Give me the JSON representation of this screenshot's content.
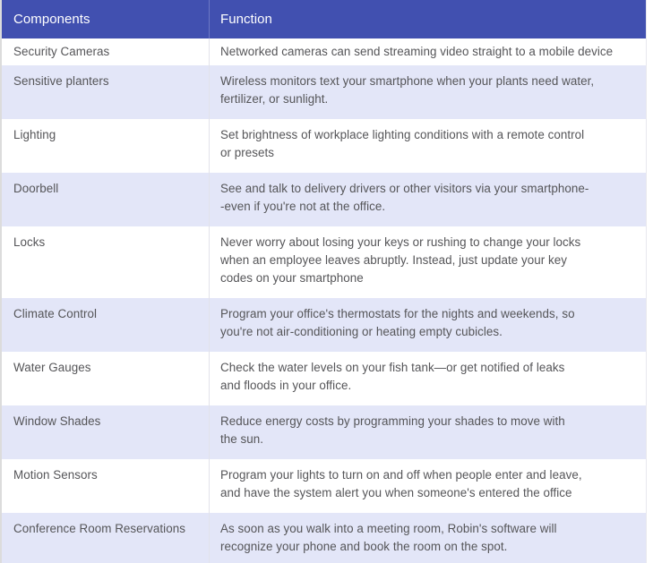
{
  "table": {
    "colors": {
      "header_bg": "#4150b0",
      "header_text": "#ffffff",
      "row_alt_bg": "#e3e6f8",
      "row_bg": "#ffffff",
      "text": "#555558"
    },
    "headers": [
      "Components",
      "Function"
    ],
    "rows": [
      {
        "component": "Security Cameras",
        "function_lines": [
          "Networked cameras can send streaming video straight to a mobile device"
        ]
      },
      {
        "component": "Sensitive planters",
        "function_lines": [
          "Wireless monitors text your smartphone when your plants need water,",
          "fertilizer, or sunlight."
        ]
      },
      {
        "component": "Lighting",
        "function_lines": [
          "Set brightness of workplace lighting conditions with a remote control",
          "or presets"
        ]
      },
      {
        "component": "Doorbell",
        "function_lines": [
          "See and talk to delivery drivers or other visitors via your smartphone-",
          "-even if you're not at the office."
        ]
      },
      {
        "component": "Locks",
        "function_lines": [
          "Never worry about losing your keys or rushing to change your locks",
          "when an employee leaves abruptly. Instead, just update your key",
          "codes on your smartphone"
        ]
      },
      {
        "component": "Climate Control",
        "function_lines": [
          "Program your office's thermostats for the nights and weekends, so",
          "you're not air-conditioning or heating empty cubicles."
        ]
      },
      {
        "component": "Water Gauges",
        "function_lines": [
          "Check the water levels on your fish tank—or get notified of leaks",
          "and floods in your office."
        ]
      },
      {
        "component": "Window Shades",
        "function_lines": [
          "Reduce energy costs by programming your shades to move with",
          "the sun."
        ]
      },
      {
        "component": "Motion Sensors",
        "function_lines": [
          "Program your lights to turn on and off when people enter and leave,",
          "and have the system alert you when someone's entered the office"
        ]
      },
      {
        "component": "Conference Room Reservations",
        "function_lines": [
          "As soon as you walk into a meeting room, Robin's software will",
          "recognize your phone and book the room on the spot."
        ]
      }
    ]
  }
}
